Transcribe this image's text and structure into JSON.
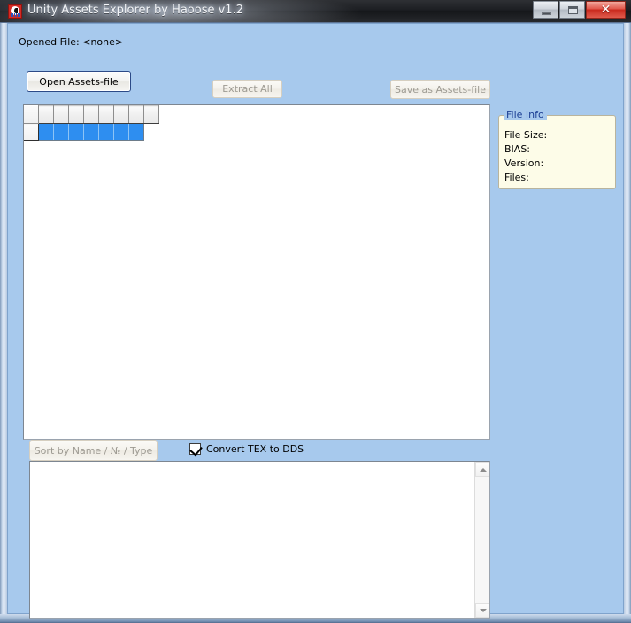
{
  "window": {
    "title": "Unity Assets Explorer by Haoose v1.2",
    "app_icon": "app-icon",
    "minimize_label": "",
    "maximize_label": "",
    "close_label": "✕",
    "client_bg": "#a7c9ed",
    "titlebar_bg": "#1c1e22"
  },
  "header": {
    "opened_file": "Opened File: <none>"
  },
  "toolbar": {
    "open_label": "Open Assets-file",
    "extract_label": "Extract All",
    "save_label": "Save as Assets-file",
    "open_enabled": true,
    "extract_enabled": false,
    "save_enabled": false
  },
  "grid": {
    "column_count": 8,
    "header_cells": [
      "",
      "",
      "",
      "",
      "",
      "",
      "",
      ""
    ],
    "rows": [
      {
        "row_header": "",
        "cells": [
          "",
          "",
          "",
          "",
          "",
          "",
          "",
          ""
        ],
        "selected": true
      }
    ]
  },
  "file_info": {
    "legend": "File Info",
    "legend_color": "#1c3f94",
    "rows": [
      {
        "label": "File Size:",
        "value": ""
      },
      {
        "label": "BIAS:",
        "value": ""
      },
      {
        "label": "Version:",
        "value": ""
      },
      {
        "label": "Files:",
        "value": ""
      }
    ]
  },
  "options": {
    "sort_label": "Sort by Name / № / Type",
    "sort_enabled": false,
    "convert_checkbox_label": "Convert TEX to DDS",
    "convert_checked": true
  },
  "log": {
    "text": "",
    "scroll_up_icon": "chevron-up-icon",
    "scroll_down_icon": "chevron-down-icon"
  }
}
